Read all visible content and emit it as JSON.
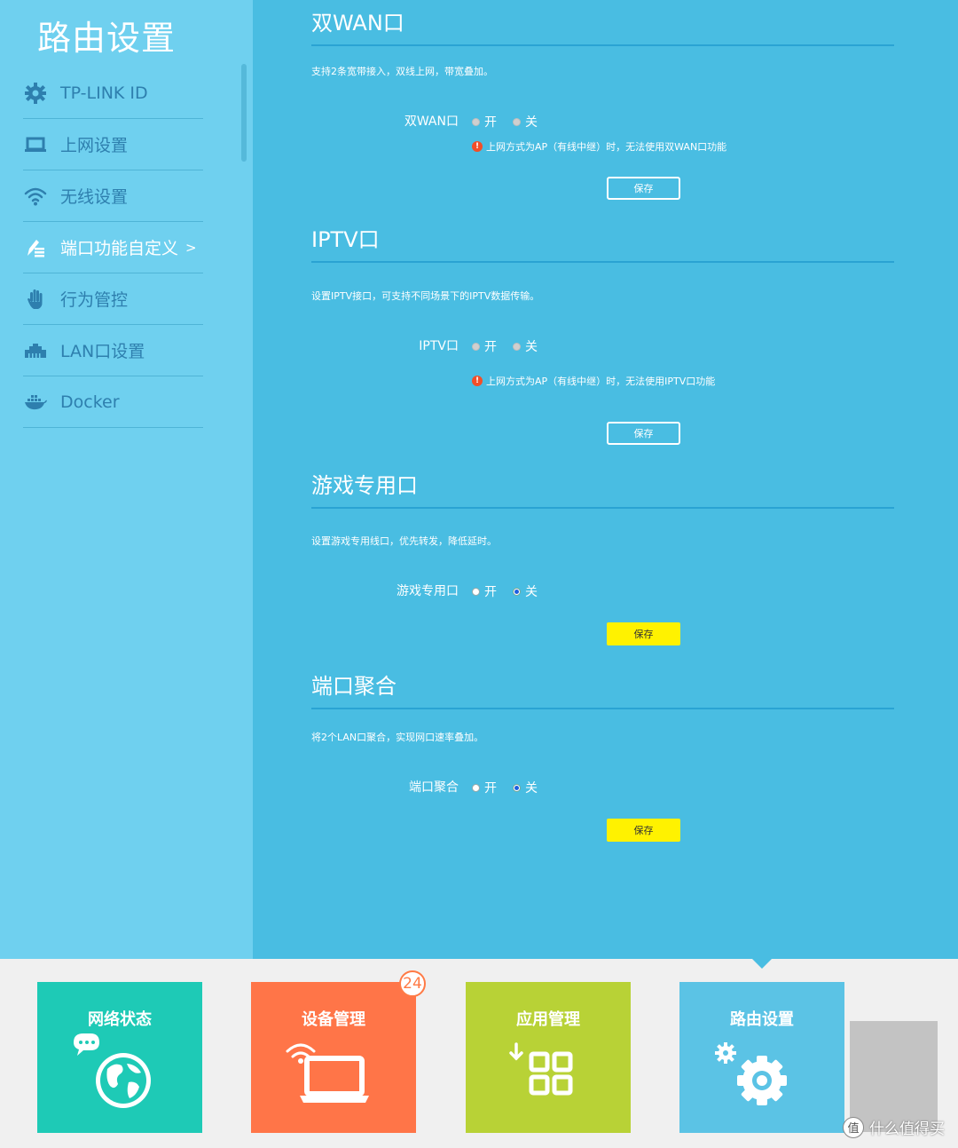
{
  "sidebar": {
    "title": "路由设置",
    "items": [
      {
        "label": "TP-LINK ID",
        "icon": "gear-icon"
      },
      {
        "label": "上网设置",
        "icon": "laptop-icon"
      },
      {
        "label": "无线设置",
        "icon": "wifi-icon"
      },
      {
        "label": "端口功能自定义",
        "icon": "edit-list-icon",
        "active": true,
        "chevron": ">"
      },
      {
        "label": "行为管控",
        "icon": "hand-icon"
      },
      {
        "label": "LAN口设置",
        "icon": "ethernet-port-icon"
      },
      {
        "label": "Docker",
        "icon": "docker-whale-icon"
      }
    ]
  },
  "sections": [
    {
      "title": "双WAN口",
      "desc": "支持2条宽带接入，双线上网，带宽叠加。",
      "field_label": "双WAN口",
      "on_label": "开",
      "off_label": "关",
      "state": "disabled",
      "warning": "上网方式为AP（有线中继）时，无法使用双WAN口功能",
      "save_label": "保存"
    },
    {
      "title": "IPTV口",
      "desc": "设置IPTV接口，可支持不同场景下的IPTV数据传输。",
      "field_label": "IPTV口",
      "on_label": "开",
      "off_label": "关",
      "state": "disabled",
      "warning": "上网方式为AP（有线中继）时，无法使用IPTV口功能",
      "save_label": "保存"
    },
    {
      "title": "游戏专用口",
      "desc": "设置游戏专用线口，优先转发，降低延时。",
      "field_label": "游戏专用口",
      "on_label": "开",
      "off_label": "关",
      "state": "off",
      "save_label": "保存"
    },
    {
      "title": "端口聚合",
      "desc": "将2个LAN口聚合，实现网口速率叠加。",
      "field_label": "端口聚合",
      "on_label": "开",
      "off_label": "关",
      "state": "off",
      "save_label": "保存"
    }
  ],
  "tabs": [
    {
      "label": "网络状态",
      "icon": "globe-chat-icon",
      "color": "#1ecab6"
    },
    {
      "label": "设备管理",
      "icon": "laptop-wifi-icon",
      "color": "#ff7548",
      "badge": "24"
    },
    {
      "label": "应用管理",
      "icon": "app-grid-icon",
      "color": "#b8d236"
    },
    {
      "label": "路由设置",
      "icon": "settings-gears-icon",
      "color": "#5bc3e5",
      "active": true
    }
  ],
  "colors": {
    "sidebar_bg": "#6fd0ef",
    "main_bg": "#49bde2",
    "save_active": "#fff200",
    "warning": "#f24e28"
  },
  "watermark": "什么值得买"
}
